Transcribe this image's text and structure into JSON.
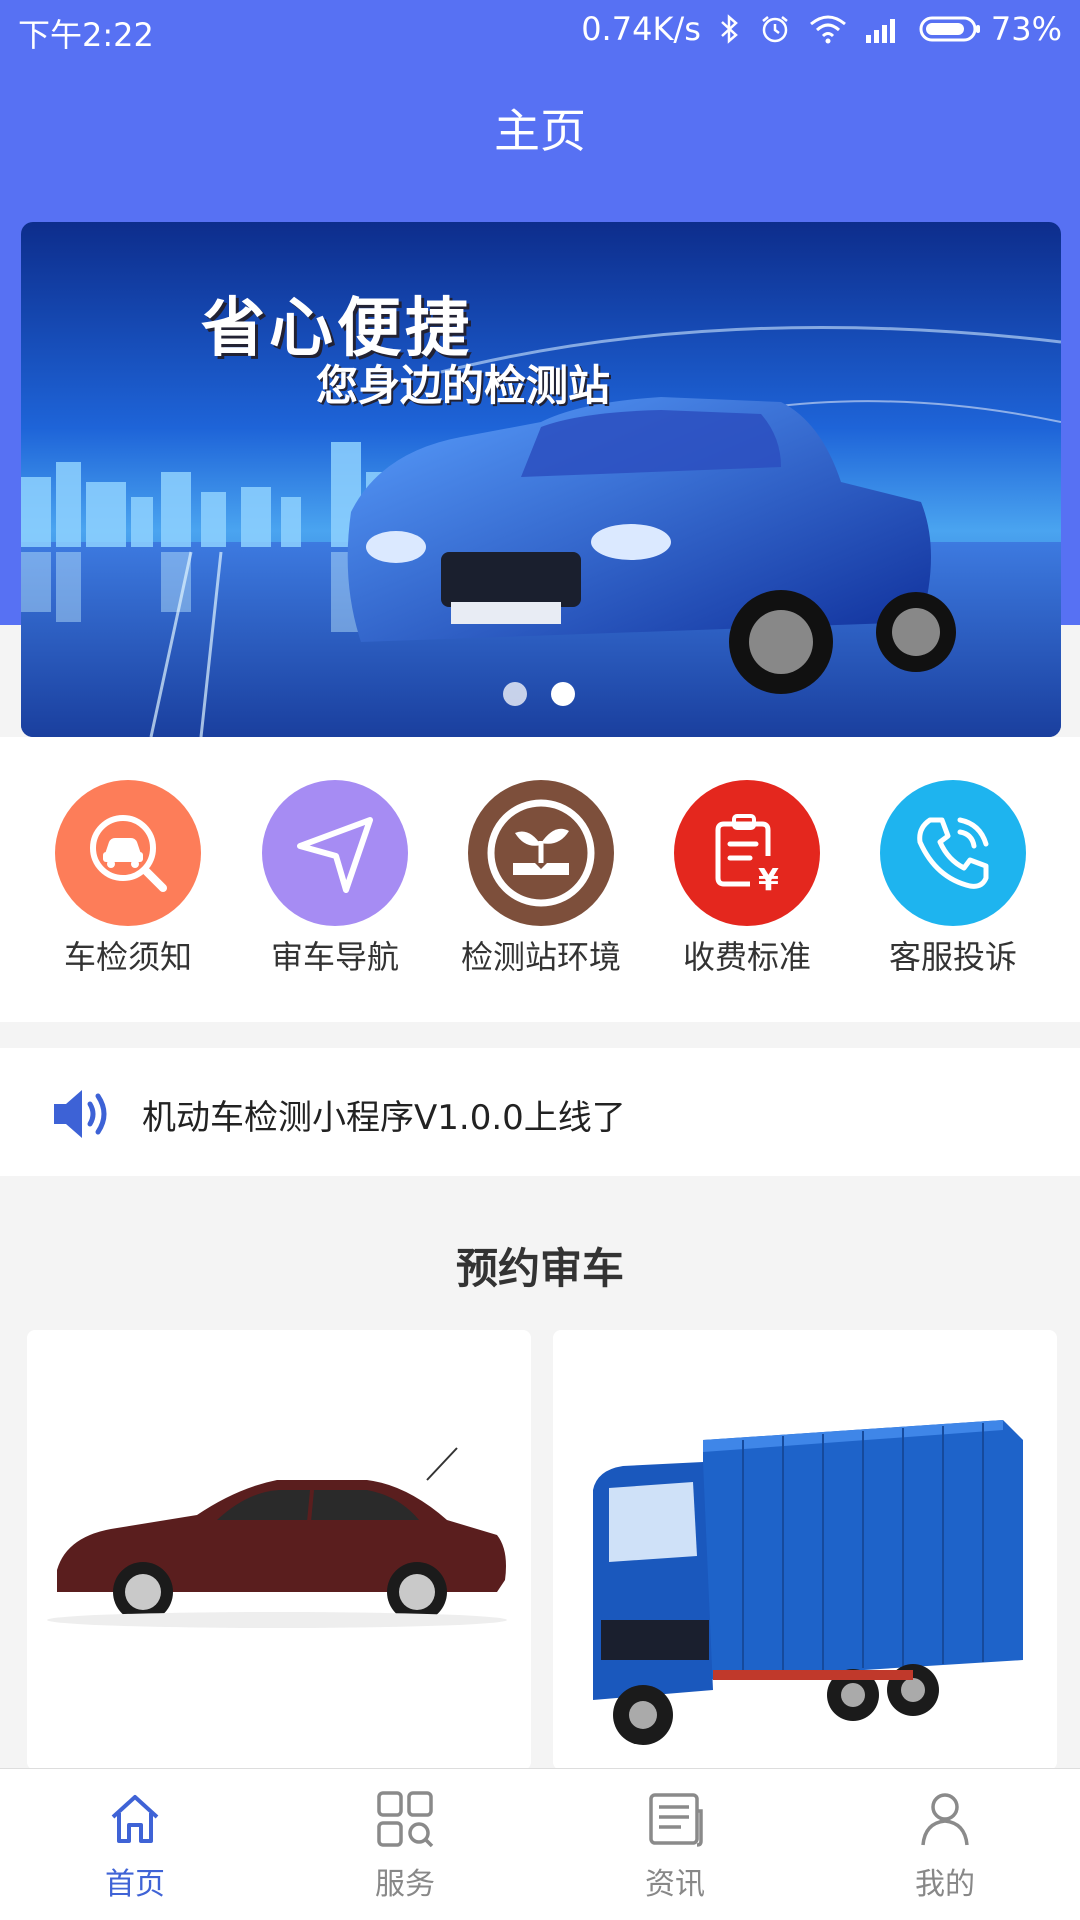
{
  "status_bar": {
    "time": "下午2:22",
    "speed": "0.74K/s",
    "battery": "73%"
  },
  "header": {
    "title": "主页"
  },
  "banner": {
    "headline": "省心便捷",
    "subline": "您身边的检测站",
    "slide_count": 2,
    "active_slide": 2
  },
  "quick_menu": [
    {
      "label": "车检须知",
      "icon": "car-search-icon",
      "color": "#fd7d59"
    },
    {
      "label": "审车导航",
      "icon": "navigation-arrow-icon",
      "color": "#a68cf3"
    },
    {
      "label": "检测站环境",
      "icon": "sprout-book-icon",
      "color": "#7d4f3b"
    },
    {
      "label": "收费标准",
      "icon": "fee-clipboard-icon",
      "color": "#e4271e"
    },
    {
      "label": "客服投诉",
      "icon": "phone-icon",
      "color": "#1eb4ef"
    }
  ],
  "notice": {
    "text": "机动车检测小程序V1.0.0上线了",
    "icon": "speaker-icon"
  },
  "booking": {
    "title": "预约审车"
  },
  "tabbar": [
    {
      "label": "首页",
      "icon": "home-icon",
      "active": true
    },
    {
      "label": "服务",
      "icon": "grid-search-icon",
      "active": false
    },
    {
      "label": "资讯",
      "icon": "news-icon",
      "active": false
    },
    {
      "label": "我的",
      "icon": "user-icon",
      "active": false
    }
  ],
  "colors": {
    "primary": "#5771f3",
    "tab_active": "#3f63d6"
  }
}
